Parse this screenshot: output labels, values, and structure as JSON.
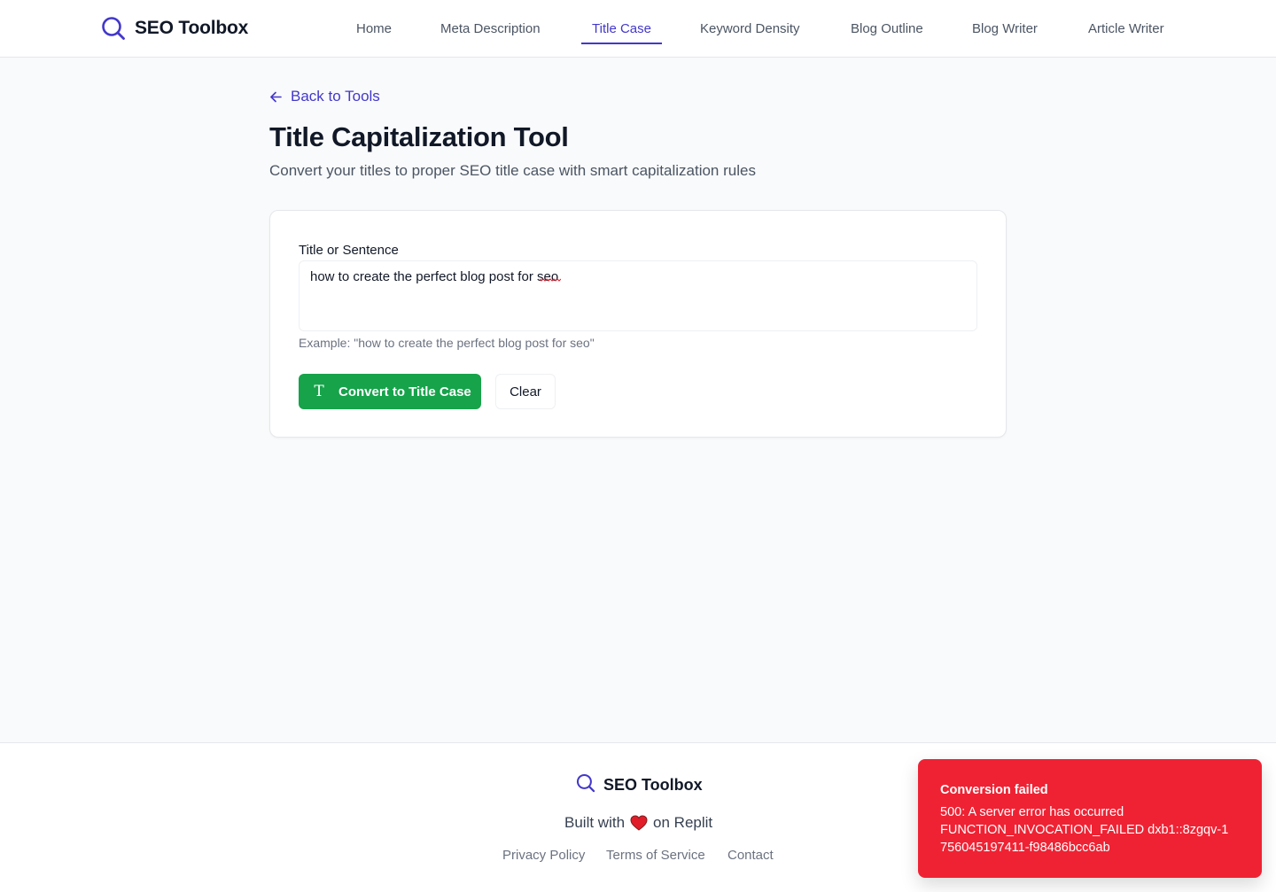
{
  "header": {
    "brand": "SEO Toolbox",
    "nav": [
      {
        "label": "Home",
        "active": false
      },
      {
        "label": "Meta Description",
        "active": false
      },
      {
        "label": "Title Case",
        "active": true
      },
      {
        "label": "Keyword Density",
        "active": false
      },
      {
        "label": "Blog Outline",
        "active": false
      },
      {
        "label": "Blog Writer",
        "active": false
      },
      {
        "label": "Article Writer",
        "active": false
      }
    ]
  },
  "main": {
    "back_label": "Back to Tools",
    "title": "Title Capitalization Tool",
    "subtitle": "Convert your titles to proper SEO title case with smart capitalization rules",
    "form": {
      "field_label": "Title or Sentence",
      "field_value": "how to create the perfect blog post for seo",
      "helper": "Example: \"how to create the perfect blog post for seo\"",
      "convert_label": "Convert to Title Case",
      "convert_icon": "T",
      "clear_label": "Clear"
    }
  },
  "footer": {
    "brand": "SEO Toolbox",
    "built_prefix": "Built with",
    "built_suffix": "on Replit",
    "links": [
      "Privacy Policy",
      "Terms of Service",
      "Contact"
    ]
  },
  "toast": {
    "title": "Conversion failed",
    "message": "500: A server error has occurred\nFUNCTION_INVOCATION_FAILED dxb1::8zgqv-1756045197411-f98486bcc6ab"
  },
  "colors": {
    "accent": "#4338ca",
    "primary_button": "#16a34a",
    "error": "#ef2233",
    "heart": "#e11d2a"
  }
}
